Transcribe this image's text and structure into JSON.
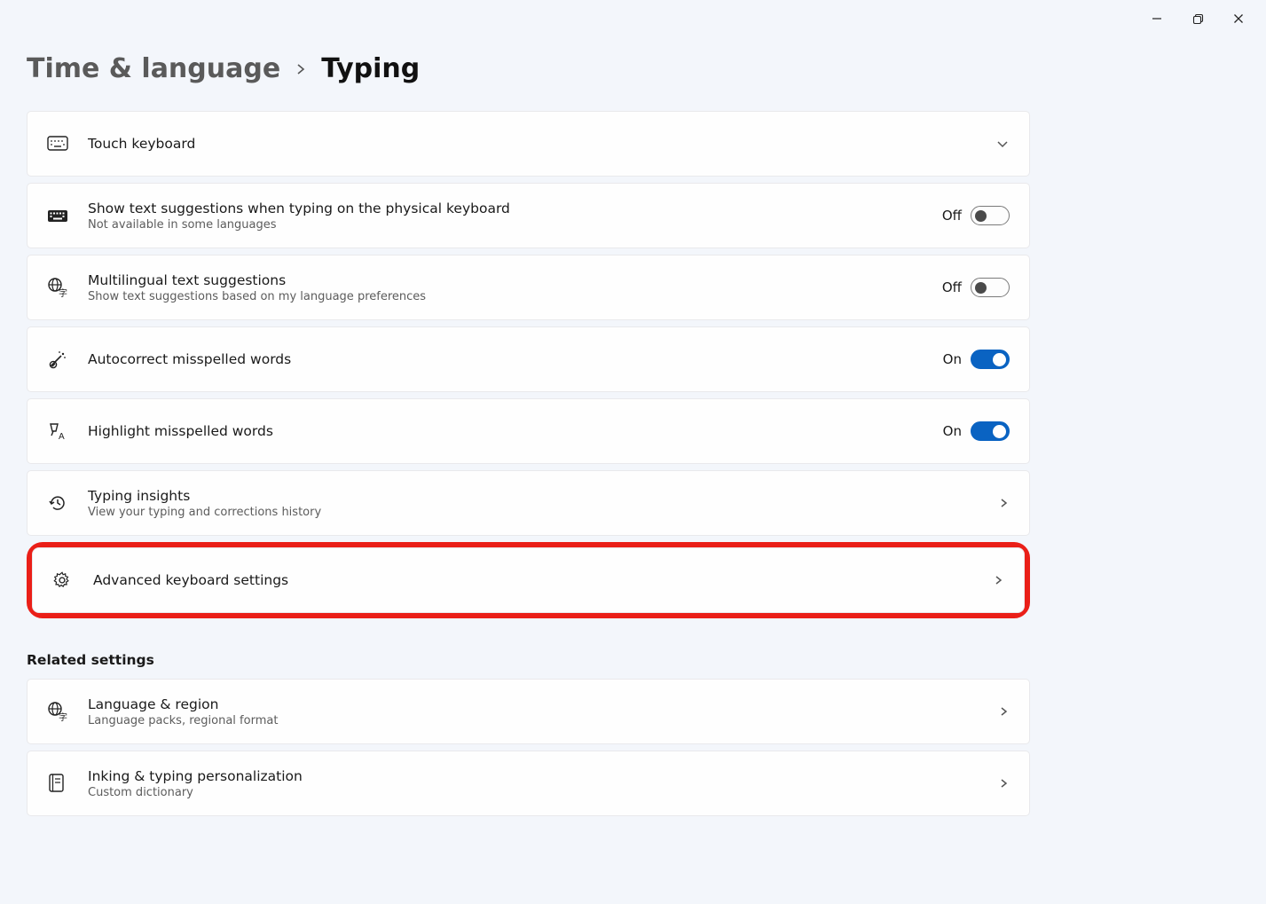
{
  "window_controls": {
    "minimize": "minimize",
    "maximize": "maximize",
    "close": "close"
  },
  "breadcrumb": {
    "parent": "Time & language",
    "current": "Typing"
  },
  "cards": {
    "touch_keyboard": {
      "title": "Touch keyboard"
    },
    "physical_suggestions": {
      "title": "Show text suggestions when typing on the physical keyboard",
      "subtitle": "Not available in some languages",
      "state": "Off"
    },
    "multilingual": {
      "title": "Multilingual text suggestions",
      "subtitle": "Show text suggestions based on my language preferences",
      "state": "Off"
    },
    "autocorrect": {
      "title": "Autocorrect misspelled words",
      "state": "On"
    },
    "highlight_misspelled": {
      "title": "Highlight misspelled words",
      "state": "On"
    },
    "typing_insights": {
      "title": "Typing insights",
      "subtitle": "View your typing and corrections history"
    },
    "advanced_keyboard": {
      "title": "Advanced keyboard settings"
    }
  },
  "related": {
    "heading": "Related settings",
    "language_region": {
      "title": "Language & region",
      "subtitle": "Language packs, regional format"
    },
    "inking": {
      "title": "Inking & typing personalization",
      "subtitle": "Custom dictionary"
    }
  }
}
